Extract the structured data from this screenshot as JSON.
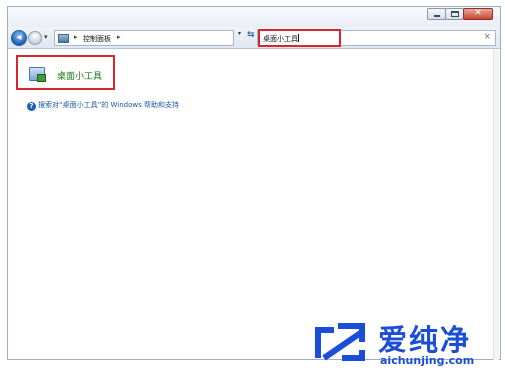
{
  "window": {
    "caption": {
      "minimize_icon": "minimize-icon",
      "maximize_icon": "maximize-icon",
      "close_icon": "close-icon",
      "close_glyph": "✕"
    }
  },
  "navigation": {
    "back_icon": "back-arrow-icon",
    "forward_icon": "forward-arrow-icon",
    "recent_icon": "chevron-down-icon",
    "recent_glyph": "▾"
  },
  "address_bar": {
    "crumb_separator": "▸",
    "breadcrumb": "控制面板",
    "trailing_separator": "▸",
    "dropdown_glyph": "▾",
    "refresh_glyph": "⇆"
  },
  "search": {
    "value": "桌面小工具",
    "clear_glyph": "×"
  },
  "results": {
    "item_title": "桌面小工具",
    "item_icon": "desktop-gadgets-icon"
  },
  "help_link": {
    "icon_glyph": "?",
    "text": "搜索对“桌面小工具”的 Windows 帮助和支持"
  },
  "highlight_color": "#d8272c",
  "watermark": {
    "cn_text": "爱纯净",
    "url": "aichunjing.com",
    "color": "#1a4dd8"
  }
}
